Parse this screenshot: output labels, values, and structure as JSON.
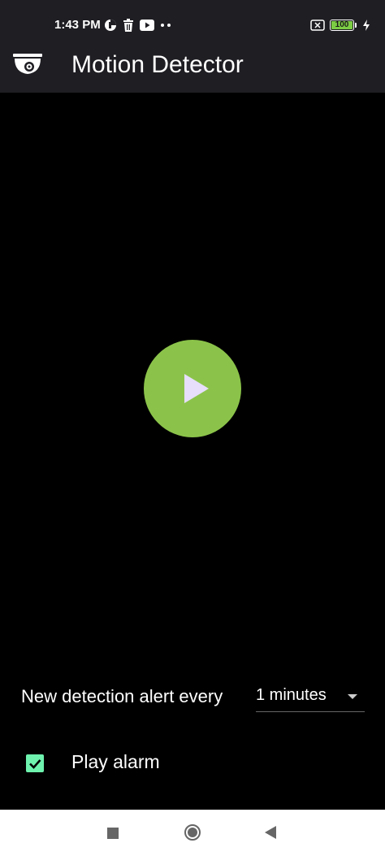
{
  "status_bar": {
    "time": "1:43 PM",
    "battery_level": "100",
    "battery_color": "#7ccd44",
    "icons_left": [
      "data-saver-icon",
      "trash-icon",
      "youtube-icon",
      "more-dots-icon"
    ],
    "icons_right": [
      "sim-off-icon",
      "battery-icon",
      "charging-bolt-icon"
    ]
  },
  "app_bar": {
    "title": "Motion Detector",
    "icon": "security-camera-icon",
    "background": "#1e1e23"
  },
  "camera": {
    "play_button_icon": "play-icon",
    "play_button_color": "#8bc34a"
  },
  "alert": {
    "label": "New detection alert every",
    "selected_value": "1 minutes"
  },
  "alarm": {
    "label": "Play alarm",
    "checked": true,
    "checkbox_color": "#6ef2ae"
  },
  "nav_bar": {
    "items": [
      "recents-square-icon",
      "home-circle-icon",
      "back-triangle-icon"
    ]
  }
}
